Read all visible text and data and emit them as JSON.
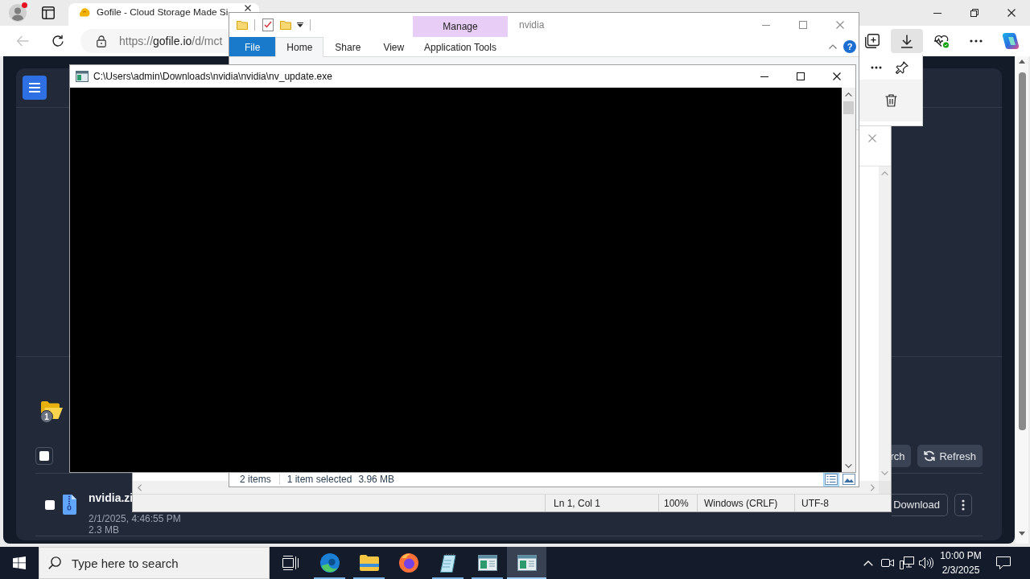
{
  "browser": {
    "profile": {
      "notification": true
    },
    "tabs": [
      {
        "title": "Gofile - Cloud Storage Made Si",
        "selected": true
      }
    ],
    "back": {
      "disabled": true
    },
    "address": {
      "scheme": "https://",
      "host": "gofile.io",
      "path": "/d/mct"
    },
    "toolbar": [
      {
        "kind": "collections",
        "active": false
      },
      {
        "kind": "downloads",
        "active": true
      },
      {
        "kind": "health",
        "active": false
      },
      {
        "kind": "more",
        "active": false
      },
      {
        "kind": "assistant",
        "active": false
      }
    ]
  },
  "page": {
    "folder_badge": "1",
    "select_all": {
      "checked": false
    },
    "actions": [
      {
        "kind": "search",
        "label": "rch"
      },
      {
        "kind": "refresh",
        "label": "Refresh"
      }
    ],
    "files": [
      {
        "name": "nvidia.zi",
        "date": "2/1/2025, 4:46:55 PM",
        "size": "2.3 MB",
        "checked": false,
        "action": "Download"
      }
    ]
  },
  "notepad": {
    "status": [
      "Ln 1, Col 1",
      "100%",
      "Windows (CRLF)",
      "UTF-8"
    ]
  },
  "explorer": {
    "title": "nvidia",
    "context_label": "Manage",
    "tabs": [
      {
        "kind": "backstage",
        "label": "File",
        "selected": false
      },
      {
        "kind": "tab",
        "label": "Home",
        "selected": true
      },
      {
        "kind": "tab",
        "label": "Share",
        "selected": false
      },
      {
        "kind": "tab",
        "label": "View",
        "selected": false
      },
      {
        "kind": "contextual",
        "label": "Application Tools",
        "selected": false
      }
    ],
    "help": "?",
    "status": {
      "count": "2 items",
      "selection": "1 item selected",
      "size": "3.96 MB"
    },
    "views": [
      {
        "kind": "details",
        "selected": true
      },
      {
        "kind": "preview",
        "selected": false
      }
    ]
  },
  "console": {
    "title": "C:\\Users\\admin\\Downloads\\nvidia\\nvidia\\nv_update.exe"
  },
  "taskbar": {
    "search_placeholder": "Type here to search",
    "apps": [
      {
        "kind": "taskview",
        "open": false,
        "selected": false
      },
      {
        "kind": "browser",
        "open": true,
        "selected": false
      },
      {
        "kind": "explorer",
        "open": true,
        "selected": false
      },
      {
        "kind": "firefox",
        "open": false,
        "selected": false
      },
      {
        "kind": "notepad",
        "open": true,
        "selected": false
      },
      {
        "kind": "window",
        "open": true,
        "selected": false
      },
      {
        "kind": "window",
        "open": true,
        "selected": true
      }
    ],
    "clock": {
      "time": "10:00 PM",
      "date": "2/3/2025"
    }
  }
}
